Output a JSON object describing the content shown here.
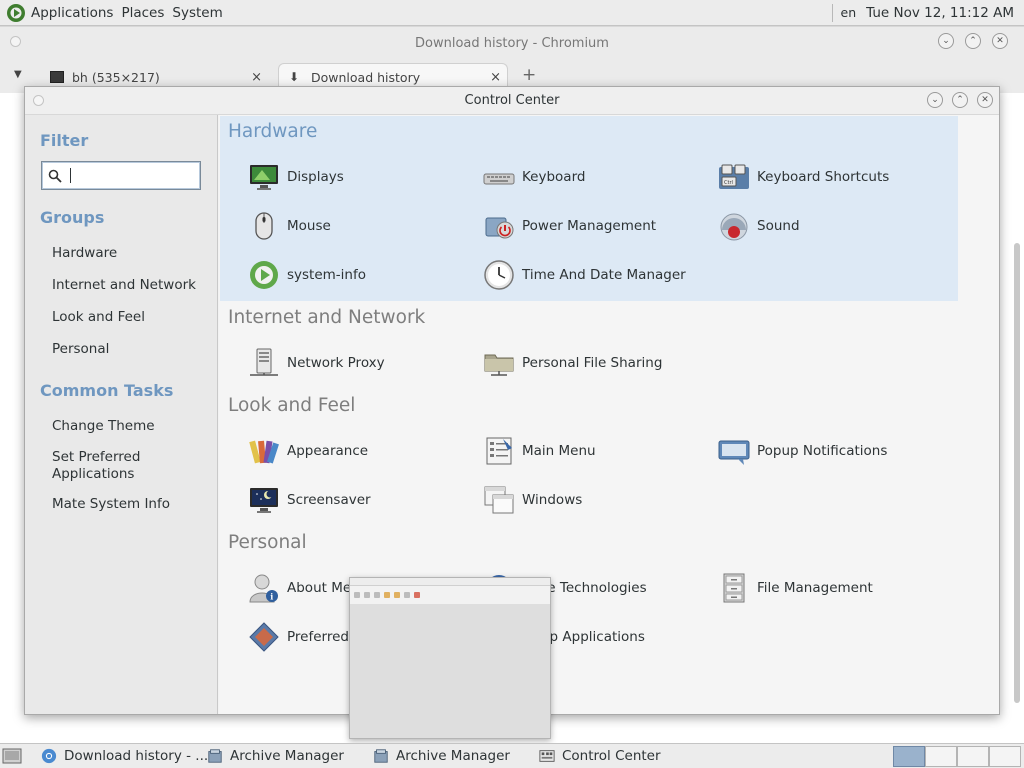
{
  "top_panel": {
    "menus": [
      "Applications",
      "Places",
      "System"
    ],
    "language": "en",
    "clock": "Tue Nov 12, 11:12 AM"
  },
  "chromium": {
    "title": "Download history - Chromium",
    "tabs": [
      {
        "label": "bh (535×217)"
      },
      {
        "label": "Download history"
      }
    ],
    "close_glyph": "×",
    "new_tab_glyph": "+"
  },
  "control_center": {
    "title": "Control Center",
    "sidebar": {
      "filter_heading": "Filter",
      "filter_value": "",
      "groups_heading": "Groups",
      "groups": [
        "Hardware",
        "Internet and Network",
        "Look and Feel",
        "Personal"
      ],
      "tasks_heading": "Common Tasks",
      "tasks": [
        "Change Theme",
        "Set Preferred Applications",
        "Mate System Info"
      ]
    },
    "groups": [
      {
        "title": "Hardware",
        "items": [
          {
            "label": "Displays",
            "icon": "display-icon"
          },
          {
            "label": "Keyboard",
            "icon": "keyboard-icon"
          },
          {
            "label": "Keyboard Shortcuts",
            "icon": "keyboard-shortcuts-icon"
          },
          {
            "label": "Mouse",
            "icon": "mouse-icon"
          },
          {
            "label": "Power Management",
            "icon": "power-icon"
          },
          {
            "label": "Sound",
            "icon": "sound-icon"
          },
          {
            "label": "system-info",
            "icon": "system-info-icon"
          },
          {
            "label": "Time And Date Manager",
            "icon": "clock-icon"
          }
        ]
      },
      {
        "title": "Internet and Network",
        "items": [
          {
            "label": "Network Proxy",
            "icon": "network-proxy-icon"
          },
          {
            "label": "Personal File Sharing",
            "icon": "file-sharing-icon"
          }
        ]
      },
      {
        "title": "Look and Feel",
        "items": [
          {
            "label": "Appearance",
            "icon": "appearance-icon"
          },
          {
            "label": "Main Menu",
            "icon": "main-menu-icon"
          },
          {
            "label": "Popup Notifications",
            "icon": "notification-icon"
          },
          {
            "label": "Screensaver",
            "icon": "screensaver-icon"
          },
          {
            "label": "Windows",
            "icon": "windows-icon"
          }
        ]
      },
      {
        "title": "Personal",
        "items": [
          {
            "label": "About Me",
            "icon": "about-me-icon"
          },
          {
            "label": "ative Technologies",
            "icon": "assistive-tech-icon"
          },
          {
            "label": "File Management",
            "icon": "file-management-icon"
          },
          {
            "label": "Preferred /",
            "icon": "preferred-apps-icon"
          },
          {
            "label": "up Applications",
            "icon": "startup-apps-icon"
          }
        ]
      }
    ]
  },
  "taskbar": {
    "tasks": [
      {
        "label": "Download history - ..."
      },
      {
        "label": "Archive Manager"
      },
      {
        "label": "Archive Manager"
      },
      {
        "label": "Control Center"
      }
    ]
  },
  "colors": {
    "accent": "#6f97c0",
    "hardware_highlight": "#dde9f5",
    "group_title": "#7e7e7e",
    "panel": "#ececec"
  }
}
